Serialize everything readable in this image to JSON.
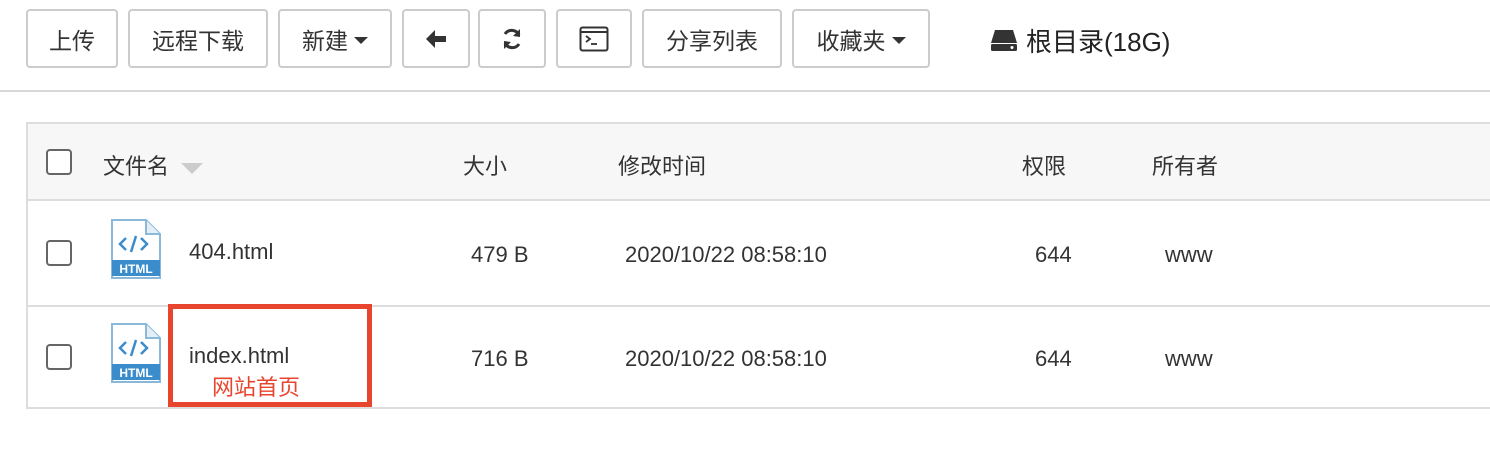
{
  "toolbar": {
    "upload": "上传",
    "remote_download": "远程下载",
    "new": "新建",
    "share_list": "分享列表",
    "favorites": "收藏夹",
    "disk_label": "根目录(18G)"
  },
  "table": {
    "columns": {
      "name": "文件名",
      "size": "大小",
      "modified": "修改时间",
      "permission": "权限",
      "owner": "所有者"
    },
    "rows": [
      {
        "icon_label": "HTML",
        "name": "404.html",
        "size": "479 B",
        "modified": "2020/10/22 08:58:10",
        "permission": "644",
        "owner": "www"
      },
      {
        "icon_label": "HTML",
        "name": "index.html",
        "size": "716 B",
        "modified": "2020/10/22 08:58:10",
        "permission": "644",
        "owner": "www"
      }
    ]
  },
  "annotation": {
    "text": "网站首页",
    "color": "#e8452e"
  }
}
